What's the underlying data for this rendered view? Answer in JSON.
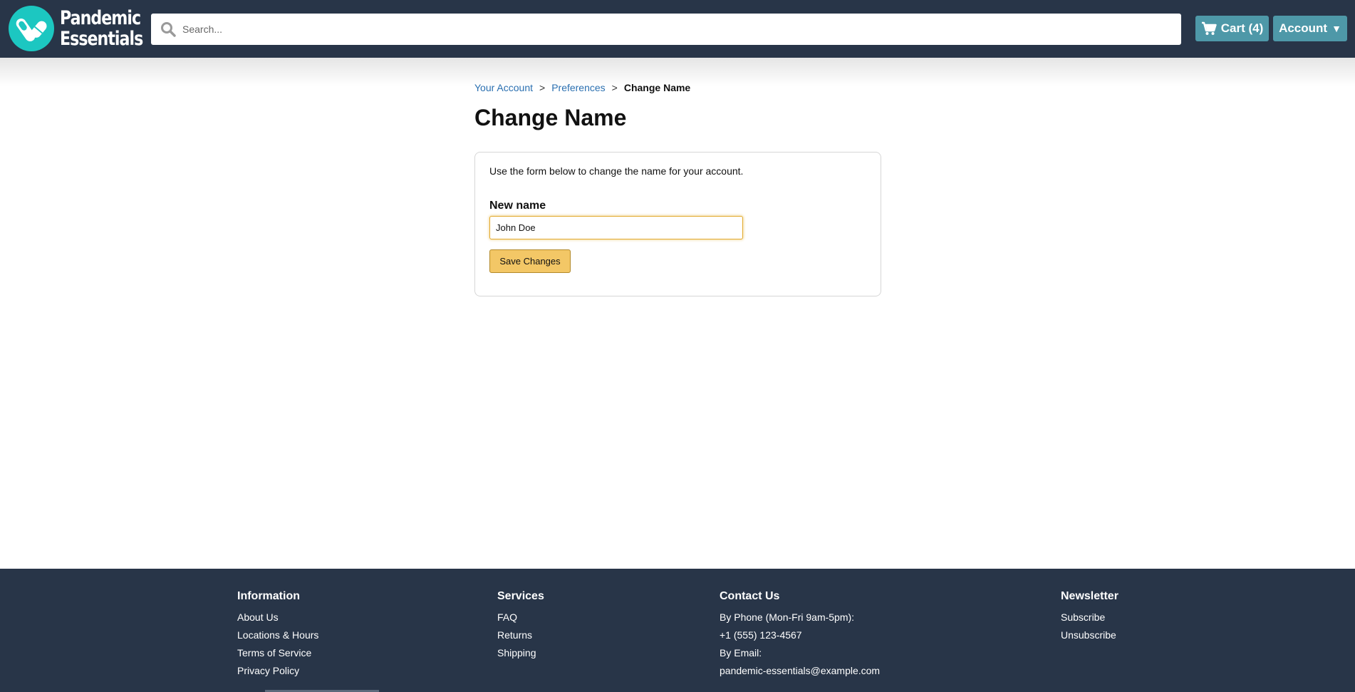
{
  "header": {
    "logo": {
      "line1": "Pandemic",
      "line2": "Essentials",
      "icon": "pill-capsule-icon"
    },
    "search": {
      "placeholder": "Search...",
      "value": ""
    },
    "cart_label": "Cart (4)",
    "account_label": "Account",
    "account_caret": "▼"
  },
  "breadcrumb": {
    "items": [
      "Your Account",
      "Preferences"
    ],
    "separator": ">",
    "current": "Change Name"
  },
  "page": {
    "title": "Change Name",
    "description": "Use the form below to change the name for your account.",
    "field_label": "New name",
    "field_value": "John Doe",
    "save_label": "Save Changes"
  },
  "footer": {
    "information": {
      "heading": "Information",
      "items": [
        "About Us",
        "Locations & Hours",
        "Terms of Service",
        "Privacy Policy"
      ]
    },
    "services": {
      "heading": "Services",
      "items": [
        "FAQ",
        "Returns",
        "Shipping"
      ]
    },
    "contact": {
      "heading": "Contact Us",
      "items": [
        "By Phone (Mon-Fri 9am-5pm):",
        "+1 (555) 123-4567",
        "By Email:",
        "pandemic-essentials@example.com"
      ]
    },
    "newsletter": {
      "heading": "Newsletter",
      "items": [
        "Subscribe",
        "Unsubscribe"
      ]
    }
  },
  "colors": {
    "header_bg": "#283548",
    "accent_teal": "#4e98a8",
    "logo_teal": "#1cc7c1",
    "save_button": "#f3c766",
    "link": "#2a6fb0"
  }
}
